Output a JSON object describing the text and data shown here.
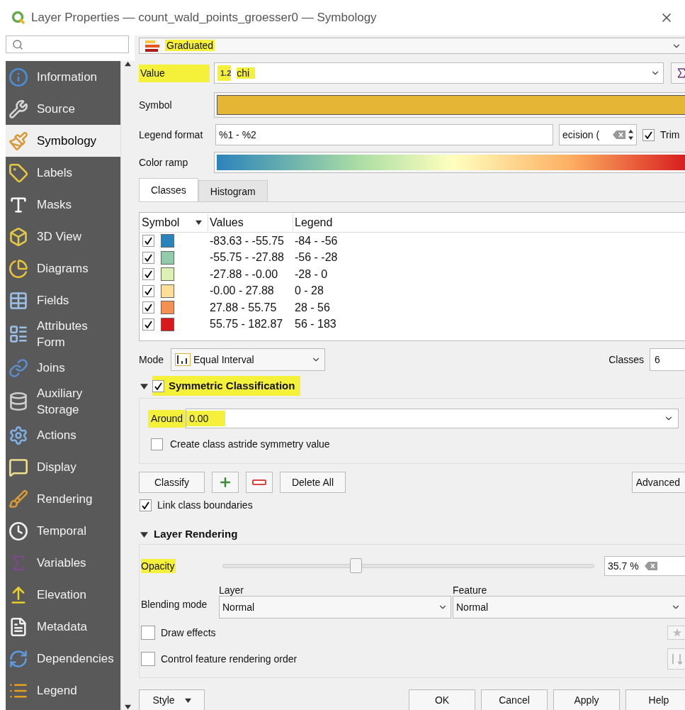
{
  "window": {
    "title": "Layer Properties — count_wald_points_groesser0 — Symbology"
  },
  "sidebar": {
    "items": [
      {
        "label": "Information",
        "selected": false
      },
      {
        "label": "Source",
        "selected": false
      },
      {
        "label": "Symbology",
        "selected": true
      },
      {
        "label": "Labels",
        "selected": false
      },
      {
        "label": "Masks",
        "selected": false
      },
      {
        "label": "3D View",
        "selected": false
      },
      {
        "label": "Diagrams",
        "selected": false
      },
      {
        "label": "Fields",
        "selected": false
      },
      {
        "label": "Attributes Form",
        "selected": false
      },
      {
        "label": "Joins",
        "selected": false
      },
      {
        "label": "Auxiliary Storage",
        "selected": false
      },
      {
        "label": "Actions",
        "selected": false
      },
      {
        "label": "Display",
        "selected": false
      },
      {
        "label": "Rendering",
        "selected": false
      },
      {
        "label": "Temporal",
        "selected": false
      },
      {
        "label": "Variables",
        "selected": false
      },
      {
        "label": "Elevation",
        "selected": false
      },
      {
        "label": "Metadata",
        "selected": false
      },
      {
        "label": "Dependencies",
        "selected": false
      },
      {
        "label": "Legend",
        "selected": false
      }
    ]
  },
  "renderer": {
    "value": "Graduated",
    "highlighted": true
  },
  "value_field": {
    "label": "Value",
    "type_badge": "1.2",
    "value": "chi",
    "highlighted": true
  },
  "symbol": {
    "label": "Symbol",
    "color": "#e5b536"
  },
  "legend_format": {
    "label": "Legend format",
    "value": "%1 - %2",
    "precision": "ecision (",
    "trim": {
      "label": "Trim",
      "checked": true
    }
  },
  "color_ramp": {
    "label": "Color ramp"
  },
  "tabs": [
    {
      "label": "Classes",
      "selected": true
    },
    {
      "label": "Histogram",
      "selected": false
    }
  ],
  "table": {
    "columns": [
      "Symbol",
      "Values",
      "Legend"
    ],
    "rows": [
      {
        "checked": true,
        "color": "#2b83ba",
        "values": "-83.63 - -55.75",
        "legend": "-84 - -56"
      },
      {
        "checked": true,
        "color": "#91cba9",
        "values": "-55.75 - -27.88",
        "legend": "-56 - -28"
      },
      {
        "checked": true,
        "color": "#ddf1b4",
        "values": "-27.88 - -0.00",
        "legend": "-28 - 0"
      },
      {
        "checked": true,
        "color": "#fedf99",
        "values": "-0.00 - 27.88",
        "legend": "0 - 28"
      },
      {
        "checked": true,
        "color": "#f59053",
        "values": "27.88 - 55.75",
        "legend": "28 - 56"
      },
      {
        "checked": true,
        "color": "#d7191c",
        "values": "55.75 - 182.87",
        "legend": "56 - 183"
      }
    ]
  },
  "mode": {
    "label": "Mode",
    "value": "Equal Interval",
    "classes_label": "Classes",
    "classes": "6"
  },
  "symmetric": {
    "title": "Symmetric Classification",
    "expanded": true,
    "checked": true,
    "highlighted": true,
    "around": {
      "label": "Around",
      "value": "0.00",
      "highlighted": true
    },
    "astride": {
      "label": "Create class astride symmetry value",
      "checked": false
    }
  },
  "actions": {
    "classify": "Classify",
    "delete_all": "Delete All",
    "advanced": "Advanced"
  },
  "link_boundaries": {
    "label": "Link class boundaries",
    "checked": true
  },
  "layer_rendering": {
    "title": "Layer Rendering",
    "expanded": true,
    "opacity": {
      "label": "Opacity",
      "level": 0.357,
      "reading": "35.7 %",
      "highlighted": true
    },
    "blending": {
      "label": "Blending mode",
      "layer_label": "Layer",
      "layer": "Normal",
      "feature_label": "Feature",
      "feature": "Normal"
    },
    "draw_effects": {
      "label": "Draw effects",
      "checked": false
    },
    "render_order": {
      "label": "Control feature rendering order",
      "checked": false
    }
  },
  "buttons": {
    "style": "Style",
    "ok": "OK",
    "cancel": "Cancel",
    "apply": "Apply",
    "help": "Help"
  }
}
